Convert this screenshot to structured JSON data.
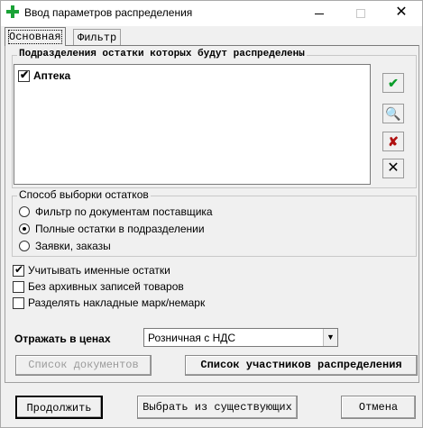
{
  "window": {
    "title": "Ввод параметров распределения",
    "controls": {
      "minimize": "minimize-icon",
      "maximize": "maximize-icon",
      "close": "✕"
    }
  },
  "tabs": [
    {
      "label": "Основная",
      "active": true
    },
    {
      "label": "Фильтр",
      "active": false
    }
  ],
  "departments": {
    "title": "Подразделения остатки которых будут распределены",
    "items": [
      {
        "label": "Аптека",
        "checked": true
      }
    ],
    "side_buttons": [
      "select-all-icon",
      "search-doc-icon",
      "deselect-icon",
      "delete-icon"
    ]
  },
  "method": {
    "title": "Способ выборки остатков",
    "options": [
      {
        "label": "Фильтр по документам поставщика",
        "checked": false
      },
      {
        "label": "Полные остатки в подразделении",
        "checked": true
      },
      {
        "label": "Заявки, заказы",
        "checked": false
      }
    ]
  },
  "options": [
    {
      "label": "Учитывать именные остатки",
      "checked": true
    },
    {
      "label": "Без архивных записей товаров",
      "checked": false
    },
    {
      "label": "Разделять накладные марк/немарк",
      "checked": false
    }
  ],
  "prices": {
    "label": "Отражать в ценах",
    "selected": "Розничная с НДС"
  },
  "buttons": {
    "documents": "Список документов",
    "participants": "Список участников распределения",
    "continue": "Продолжить",
    "choose_existing": "Выбрать из существующих",
    "cancel": "Отмена"
  }
}
